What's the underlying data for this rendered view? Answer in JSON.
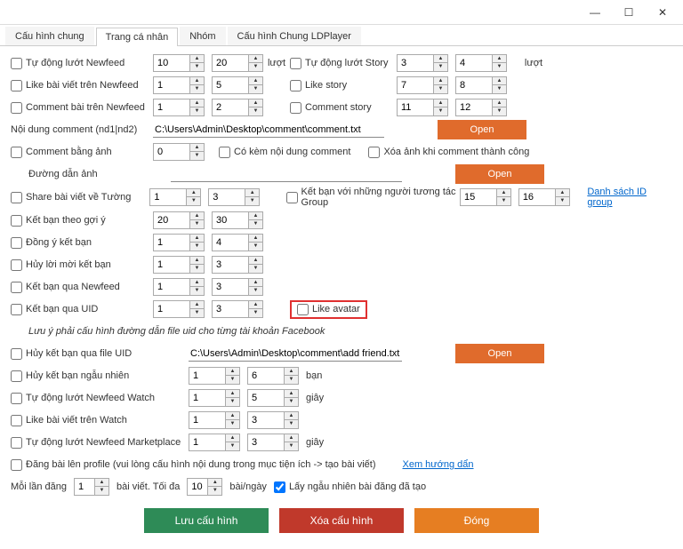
{
  "window": {
    "min": "—",
    "max": "☐",
    "close": "✕"
  },
  "tabs": [
    "Cấu hình chung",
    "Trang cá nhân",
    "Nhóm",
    "Cấu hình Chung LDPlayer"
  ],
  "labels": {
    "autoScrollNewfeed": "Tự động lướt Newfeed",
    "likeNewfeed": "Like bài viết trên Newfeed",
    "commentNewfeed": "Comment bài trên Newfeed",
    "commentContent": "Nội dung comment (nd1|nd2)",
    "commentImage": "Comment bằng ảnh",
    "attachComment": "Có kèm nội dung comment",
    "deleteImage": "Xóa ảnh khi comment thành công",
    "imagePath": "Đường dẫn ảnh",
    "luot": "lượt",
    "autoScrollStory": "Tự động lướt Story",
    "likeStory": "Like story",
    "commentStory": "Comment story",
    "shareWall": "Share bài viết về Tường",
    "friendSuggest": "Kết bạn theo gợi ý",
    "acceptFriend": "Đồng ý kết bạn",
    "cancelInvite": "Hủy lời mời kết bạn",
    "friendNewfeed": "Kết bạn qua Newfeed",
    "friendUID": "Kết bạn qua UID",
    "likeAvatar": "Like avatar",
    "uidNote": "Lưu ý phải cấu hình đường dẫn file uid cho từng tài khoản Facebook",
    "friendGroup": "Kết bạn với những người tương tác Group",
    "groupLink": "Danh sách ID group",
    "unfriendFile": "Hủy kết bạn qua file UID",
    "unfriendRandom": "Hủy kết bạn ngẫu nhiên",
    "autoWatch": "Tự động lướt Newfeed Watch",
    "likeWatch": "Like bài viết trên Watch",
    "autoMarket": "Tự động lướt Newfeed Marketplace",
    "ban": "bạn",
    "giay": "giây",
    "postProfile": "Đăng bài lên profile (vui lòng cấu hình nội dung trong mục tiện  ích -> tạo bài viết)",
    "guide": "Xem hướng dẩn",
    "eachPost": "Mỗi lần đăng",
    "postMax": "bài viết. Tối đa",
    "postDay": "bài/ngày",
    "randomPost": "Lấy ngẫu nhiên bài đăng đã tạo"
  },
  "values": {
    "newfeed1": "10",
    "newfeed2": "20",
    "like1": "1",
    "like2": "5",
    "comment1": "1",
    "comment2": "2",
    "commentPath": "C:\\Users\\Admin\\Desktop\\comment\\comment.txt",
    "commentImg": "0",
    "story1": "3",
    "story2": "4",
    "likestory1": "7",
    "likestory2": "8",
    "commentstory1": "11",
    "commentstory2": "12",
    "share1": "1",
    "share2": "3",
    "suggest1": "20",
    "suggest2": "30",
    "accept1": "1",
    "accept2": "4",
    "cancel1": "1",
    "cancel2": "3",
    "fnew1": "1",
    "fnew2": "3",
    "fuid1": "1",
    "fuid2": "3",
    "group1": "15",
    "group2": "16",
    "addFriendPath": "C:\\Users\\Admin\\Desktop\\comment\\add friend.txt",
    "unrand1": "1",
    "unrand2": "6",
    "watch1": "1",
    "watch2": "5",
    "likewatch1": "1",
    "likewatch2": "3",
    "market1": "1",
    "market2": "3",
    "each": "1",
    "max": "10"
  },
  "buttons": {
    "open": "Open",
    "save": "Lưu cấu hình",
    "delete": "Xóa cấu hình",
    "close": "Đóng"
  }
}
